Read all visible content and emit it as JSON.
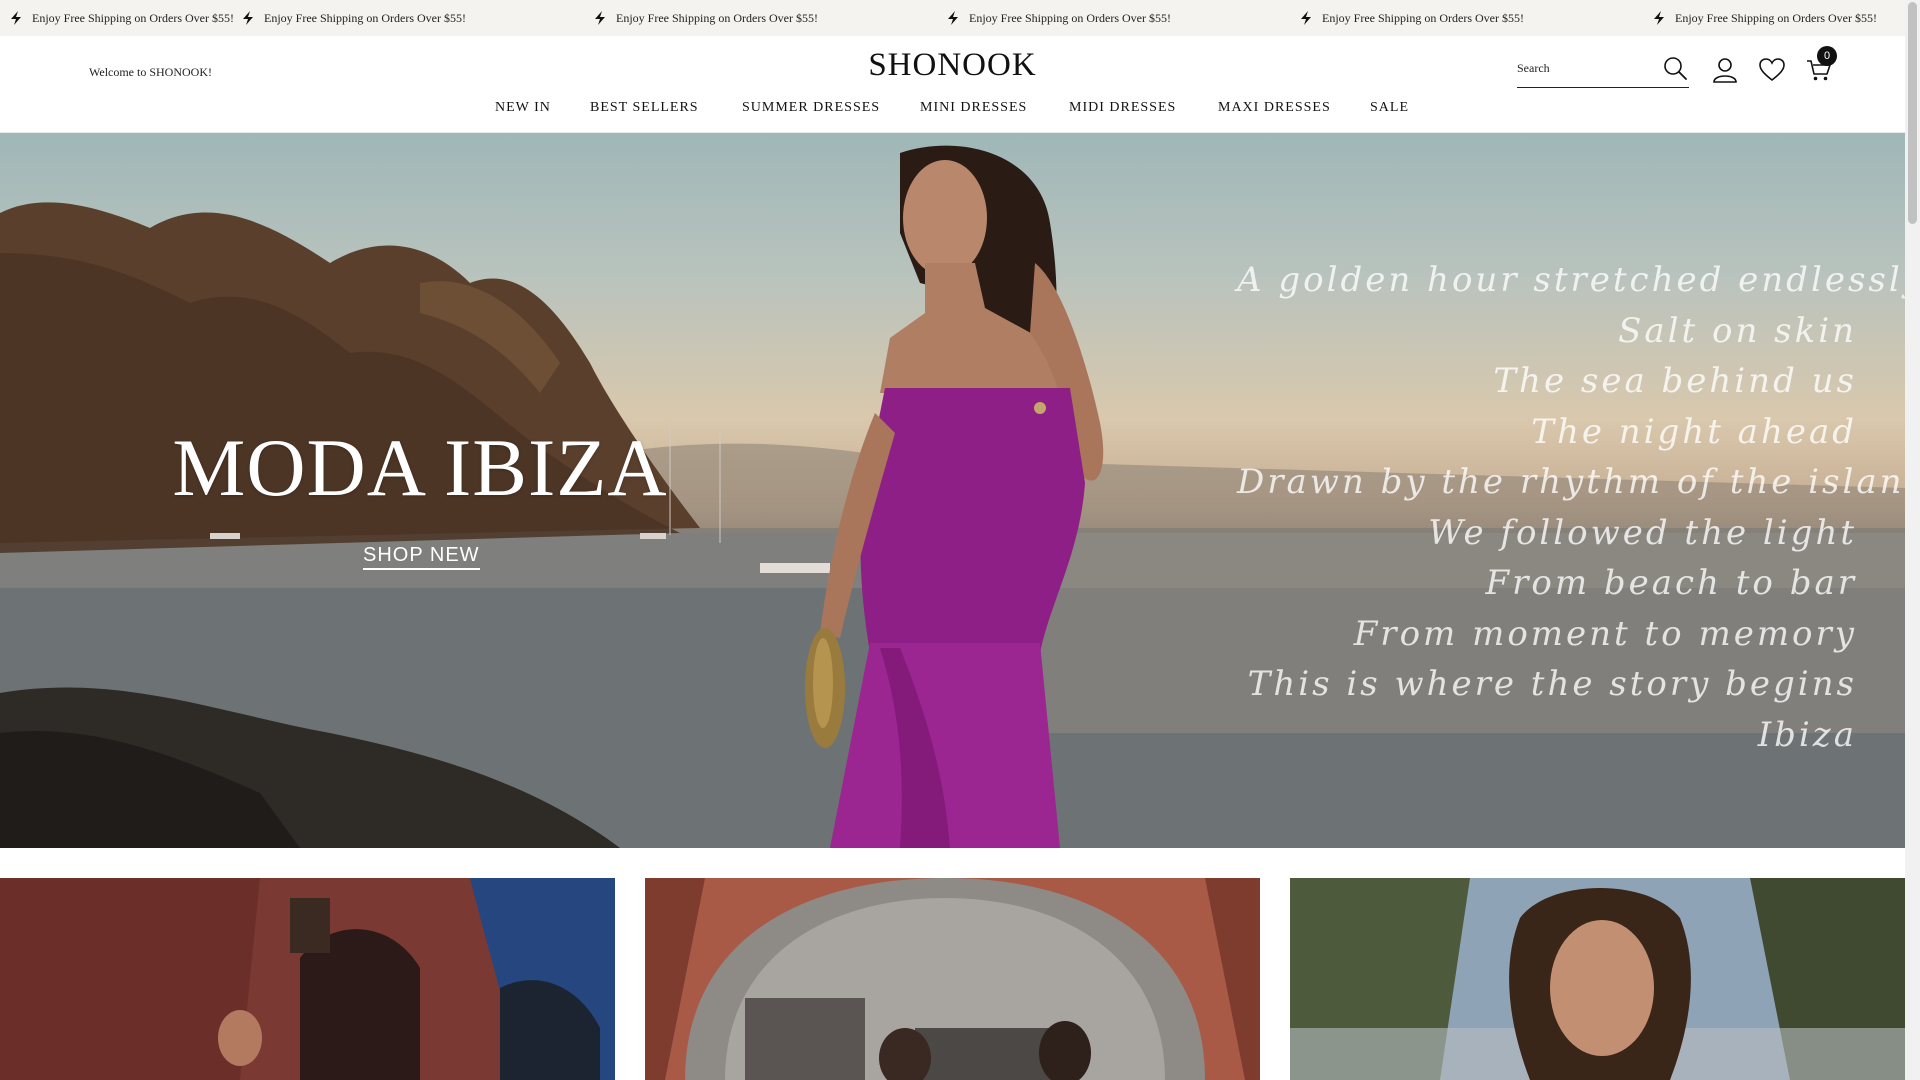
{
  "announcement": {
    "messages": [
      "Enjoy Free Shipping on Orders Over $55!",
      "Enjoy Free Shipping on Orders Over $55!",
      "Enjoy Free Shipping on Orders Over $55!",
      "Enjoy Free Shipping on Orders Over $55!",
      "Enjoy Free Shipping on Orders Over $55!",
      "Enjoy Free Shipping on Orders Over $55!"
    ]
  },
  "header": {
    "welcome": "Welcome to SHONOOK!",
    "logo": "SHONOOK",
    "search_placeholder": "Search",
    "cart_count": "0"
  },
  "nav": {
    "items": [
      "NEW IN",
      "BEST SELLERS",
      "SUMMER DRESSES",
      "MINI DRESSES",
      "MIDI DRESSES",
      "MAXI DRESSES",
      "SALE"
    ]
  },
  "hero": {
    "title": "MODA IBIZA",
    "cta": "SHOP NEW",
    "poem": [
      "A golden hour stretched endlessly",
      "Salt on skin",
      "The sea behind us",
      "The night ahead",
      "Drawn by the rhythm of the island",
      "We followed the light",
      "From beach to bar",
      "From moment to memory",
      "This is where the story begins",
      "Ibiza"
    ]
  },
  "colors": {
    "topbar_bg": "#f5f3f0",
    "text": "#111111",
    "dress": "#8e1f86",
    "badge": "#111111"
  }
}
